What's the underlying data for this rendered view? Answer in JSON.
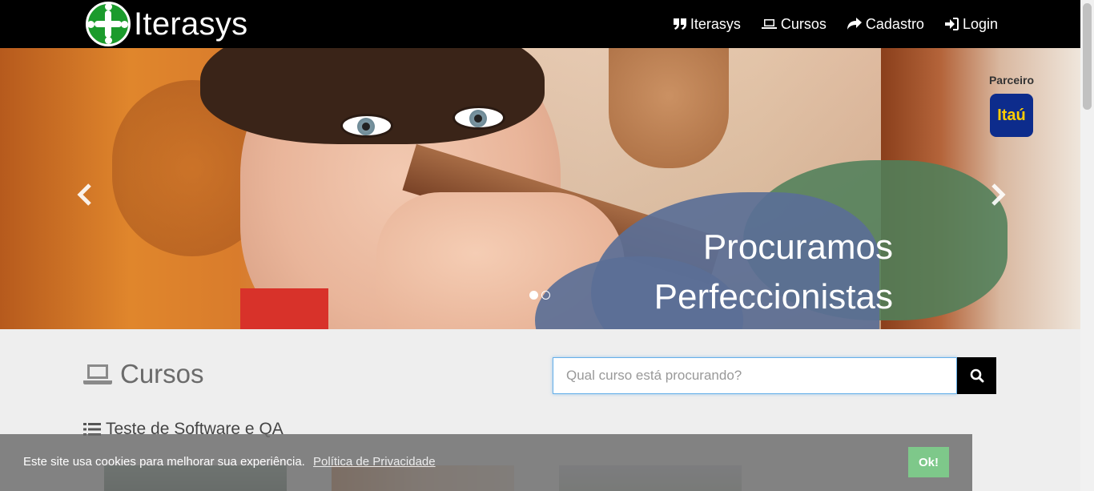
{
  "navbar": {
    "brand": "Iterasys",
    "items": [
      {
        "label": "Iterasys",
        "icon": "quote-icon"
      },
      {
        "label": "Cursos",
        "icon": "laptop-icon"
      },
      {
        "label": "Cadastro",
        "icon": "share-icon"
      },
      {
        "label": "Login",
        "icon": "login-icon"
      }
    ]
  },
  "carousel": {
    "caption_line1": "Procuramos",
    "caption_line2": "Perfeccionistas",
    "partner_label": "Parceiro",
    "partner_logo": "Itaú",
    "slides": 2,
    "active_slide": 1
  },
  "courses": {
    "title": "Cursos",
    "search_placeholder": "Qual curso está procurando?",
    "category": "Teste de Software e QA"
  },
  "cookie": {
    "text": "Este site usa cookies para melhorar sua experiência.",
    "link": "Política de Privacidade",
    "ok": "Ok!"
  },
  "colors": {
    "brand_green": "#1b9b2c",
    "navbar": "#000000",
    "cookie_ok": "#7ec88a"
  }
}
